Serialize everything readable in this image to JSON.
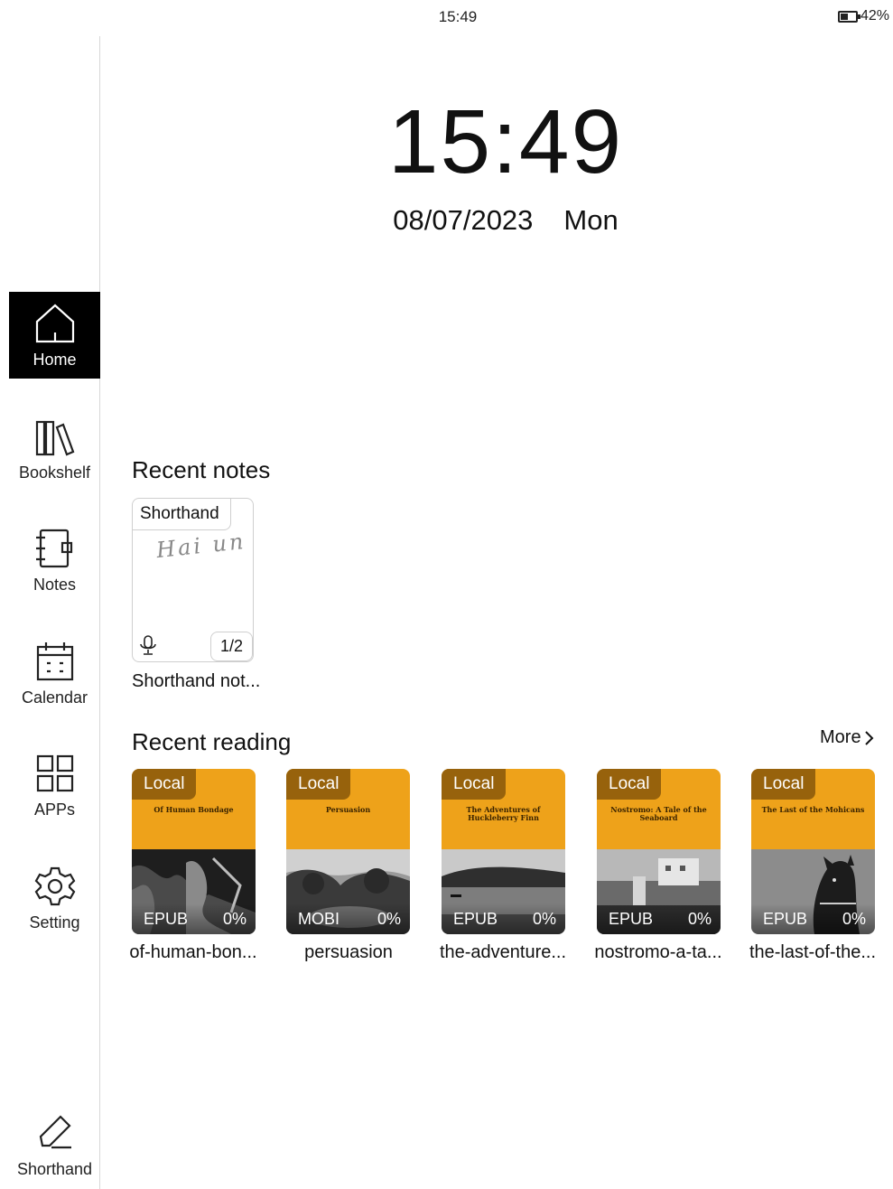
{
  "status": {
    "time": "15:49",
    "battery": "42%",
    "battery_level": 0.42
  },
  "clock": {
    "time": "15:49",
    "date": "08/07/2023",
    "weekday": "Mon"
  },
  "sidebar": {
    "items": [
      {
        "label": "Home",
        "icon": "home-icon",
        "active": true
      },
      {
        "label": "Bookshelf",
        "icon": "bookshelf-icon"
      },
      {
        "label": "Notes",
        "icon": "notebook-icon"
      },
      {
        "label": "Calendar",
        "icon": "calendar-icon"
      },
      {
        "label": "APPs",
        "icon": "apps-grid-icon"
      },
      {
        "label": "Setting",
        "icon": "gear-icon"
      }
    ],
    "bottom": {
      "label": "Shorthand",
      "icon": "pen-icon"
    }
  },
  "recent_notes": {
    "title": "Recent notes",
    "notes": [
      {
        "tag": "Shorthand",
        "handwriting": "Hai un",
        "page": "1/2",
        "name": "Shorthand not..."
      }
    ]
  },
  "recent_reading": {
    "title": "Recent reading",
    "more": "More",
    "books": [
      {
        "tag": "Local",
        "cover_title": "Of Human Bondage",
        "format": "EPUB",
        "progress": "0%",
        "name": "of-human-bon..."
      },
      {
        "tag": "Local",
        "cover_title": "Persuasion",
        "format": "MOBI",
        "progress": "0%",
        "name": "persuasion"
      },
      {
        "tag": "Local",
        "cover_title": "The Adventures of Huckleberry Finn",
        "format": "EPUB",
        "progress": "0%",
        "name": "the-adventure..."
      },
      {
        "tag": "Local",
        "cover_title": "Nostromo: A Tale of the Seaboard",
        "format": "EPUB",
        "progress": "0%",
        "name": "nostromo-a-ta..."
      },
      {
        "tag": "Local",
        "cover_title": "The Last of the Mohicans",
        "format": "EPUB",
        "progress": "0%",
        "name": "the-last-of-the..."
      }
    ]
  },
  "colors": {
    "cover_orange": "#eea21a",
    "tag_brown": "#97620c",
    "active_nav": "#000000"
  }
}
